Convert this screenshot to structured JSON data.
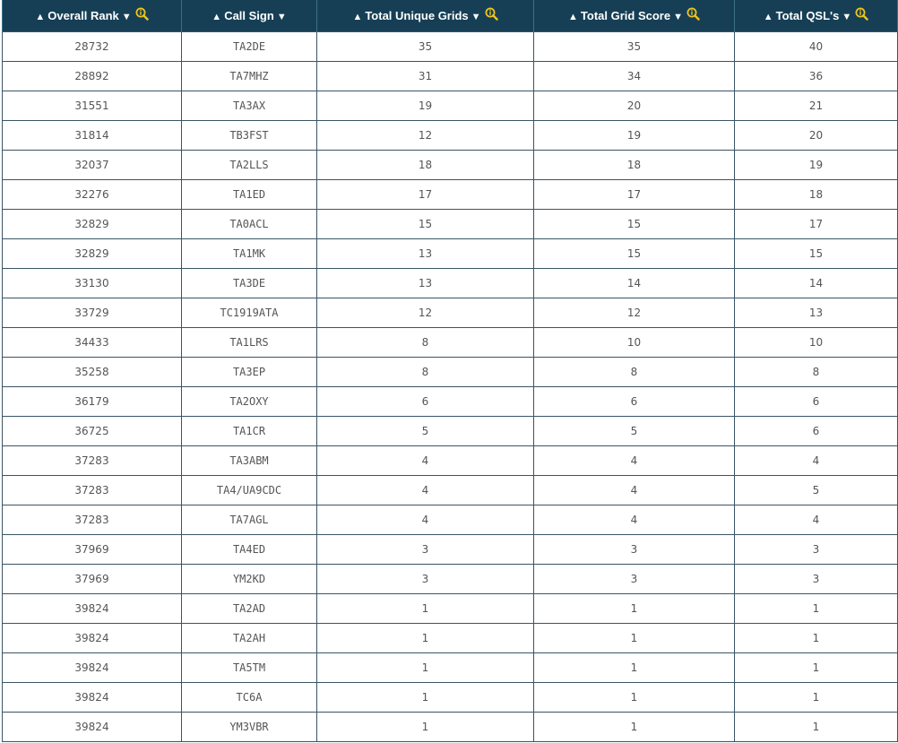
{
  "header": {
    "columns": [
      {
        "label": "Overall Rank",
        "up": "▲",
        "down": "▼",
        "icon": "magnifier-info-icon",
        "has_icon": true
      },
      {
        "label": "Call Sign",
        "up": "▲",
        "down": "▼",
        "has_icon": false
      },
      {
        "label": "Total Unique Grids",
        "up": "▲",
        "down": "▼",
        "icon": "magnifier-info-icon",
        "has_icon": true
      },
      {
        "label": "Total Grid Score",
        "up": "▲",
        "down": "▼",
        "icon": "magnifier-info-icon",
        "has_icon": true
      },
      {
        "label": "Total QSL's",
        "up": "▲",
        "down": "▼",
        "icon": "magnifier-info-icon",
        "has_icon": true
      }
    ]
  },
  "colors": {
    "header_bg": "#163f56",
    "header_text": "#ffffff",
    "icon": "#f0c419",
    "border": "#3a5466",
    "cell_text": "#555555"
  },
  "rows": [
    [
      "28732",
      "TA2DE",
      "35",
      "35",
      "40"
    ],
    [
      "28892",
      "TA7MHZ",
      "31",
      "34",
      "36"
    ],
    [
      "31551",
      "TA3AX",
      "19",
      "20",
      "21"
    ],
    [
      "31814",
      "TB3FST",
      "12",
      "19",
      "20"
    ],
    [
      "32037",
      "TA2LLS",
      "18",
      "18",
      "19"
    ],
    [
      "32276",
      "TA1ED",
      "17",
      "17",
      "18"
    ],
    [
      "32829",
      "TA0ACL",
      "15",
      "15",
      "17"
    ],
    [
      "32829",
      "TA1MK",
      "13",
      "15",
      "15"
    ],
    [
      "33130",
      "TA3DE",
      "13",
      "14",
      "14"
    ],
    [
      "33729",
      "TC1919ATA",
      "12",
      "12",
      "13"
    ],
    [
      "34433",
      "TA1LRS",
      "8",
      "10",
      "10"
    ],
    [
      "35258",
      "TA3EP",
      "8",
      "8",
      "8"
    ],
    [
      "36179",
      "TA2OXY",
      "6",
      "6",
      "6"
    ],
    [
      "36725",
      "TA1CR",
      "5",
      "5",
      "6"
    ],
    [
      "37283",
      "TA3ABM",
      "4",
      "4",
      "4"
    ],
    [
      "37283",
      "TA4/UA9CDC",
      "4",
      "4",
      "5"
    ],
    [
      "37283",
      "TA7AGL",
      "4",
      "4",
      "4"
    ],
    [
      "37969",
      "TA4ED",
      "3",
      "3",
      "3"
    ],
    [
      "37969",
      "YM2KD",
      "3",
      "3",
      "3"
    ],
    [
      "39824",
      "TA2AD",
      "1",
      "1",
      "1"
    ],
    [
      "39824",
      "TA2AH",
      "1",
      "1",
      "1"
    ],
    [
      "39824",
      "TA5TM",
      "1",
      "1",
      "1"
    ],
    [
      "39824",
      "TC6A",
      "1",
      "1",
      "1"
    ],
    [
      "39824",
      "YM3VBR",
      "1",
      "1",
      "1"
    ]
  ]
}
